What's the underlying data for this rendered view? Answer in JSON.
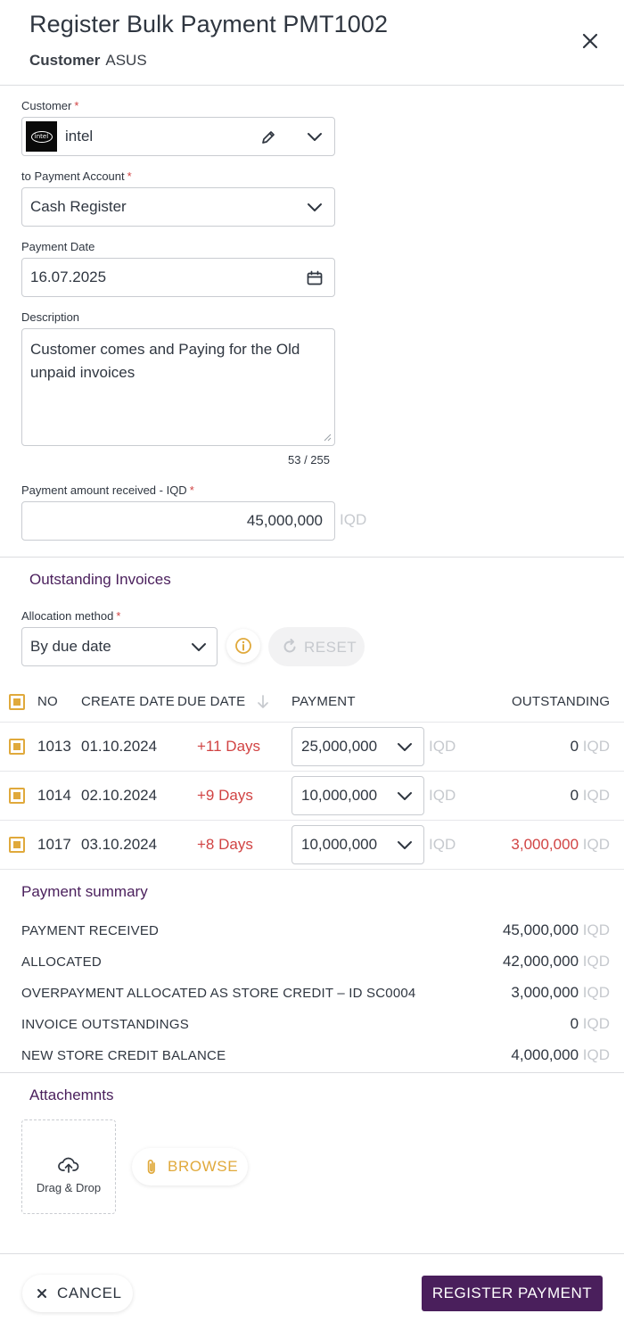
{
  "header": {
    "title": "Register Bulk Payment PMT1002",
    "customer_key": "Customer",
    "customer_value": "ASUS"
  },
  "form": {
    "customer": {
      "label": "Customer",
      "required": "*",
      "value": "intel",
      "logo_text": "intel"
    },
    "payment_account": {
      "label": "to Payment Account",
      "required": "*",
      "value": "Cash Register"
    },
    "payment_date": {
      "label": "Payment Date",
      "value": "16.07.2025"
    },
    "description": {
      "label": "Description",
      "value": "Customer comes and Paying for the Old unpaid invoices",
      "counter": "53 / 255"
    },
    "amount": {
      "label": "Payment amount received - IQD",
      "required": "*",
      "value": "45,000,000",
      "currency": "IQD"
    }
  },
  "outstanding": {
    "title": "Outstanding Invoices",
    "allocation": {
      "label": "Allocation method",
      "required": "*",
      "value": "By due date"
    },
    "reset_label": "RESET",
    "columns": {
      "no": "NO",
      "create_date": "CREATE DATE",
      "due_date": "DUE DATE",
      "payment": "PAYMENT",
      "outstanding": "OUTSTANDING"
    },
    "rows": [
      {
        "no": "1013",
        "create_date": "01.10.2024",
        "due": "+11 Days",
        "payment": "25,000,000",
        "currency": "IQD",
        "outstanding": "0",
        "outstanding_color": "#2f3640"
      },
      {
        "no": "1014",
        "create_date": "02.10.2024",
        "due": "+9 Days",
        "payment": "10,000,000",
        "currency": "IQD",
        "outstanding": "0",
        "outstanding_color": "#2f3640"
      },
      {
        "no": "1017",
        "create_date": "03.10.2024",
        "due": "+8 Days",
        "payment": "10,000,000",
        "currency": "IQD",
        "outstanding": "3,000,000",
        "outstanding_color": "#d14343"
      }
    ]
  },
  "summary": {
    "title": "Payment summary",
    "currency": "IQD",
    "items": [
      {
        "label": "PAYMENT RECEIVED",
        "value": "45,000,000"
      },
      {
        "label": "ALLOCATED",
        "value": "42,000,000"
      },
      {
        "label": "OVERPAYMENT ALLOCATED AS STORE CREDIT – ID SC0004",
        "value": "3,000,000"
      },
      {
        "label": "INVOICE OUTSTANDINGS",
        "value": "0"
      },
      {
        "label": "NEW STORE CREDIT BALANCE",
        "value": "4,000,000"
      }
    ]
  },
  "attachments": {
    "title": "Attachemnts",
    "drop_label": "Drag & Drop",
    "browse_label": "BROWSE"
  },
  "footer": {
    "cancel_label": "CANCEL",
    "register_label": "REGISTER PAYMENT"
  },
  "colors": {
    "brand": "#4a1f5c",
    "accent": "#e0a93b",
    "danger": "#d14343",
    "muted": "#c6c9ce"
  }
}
